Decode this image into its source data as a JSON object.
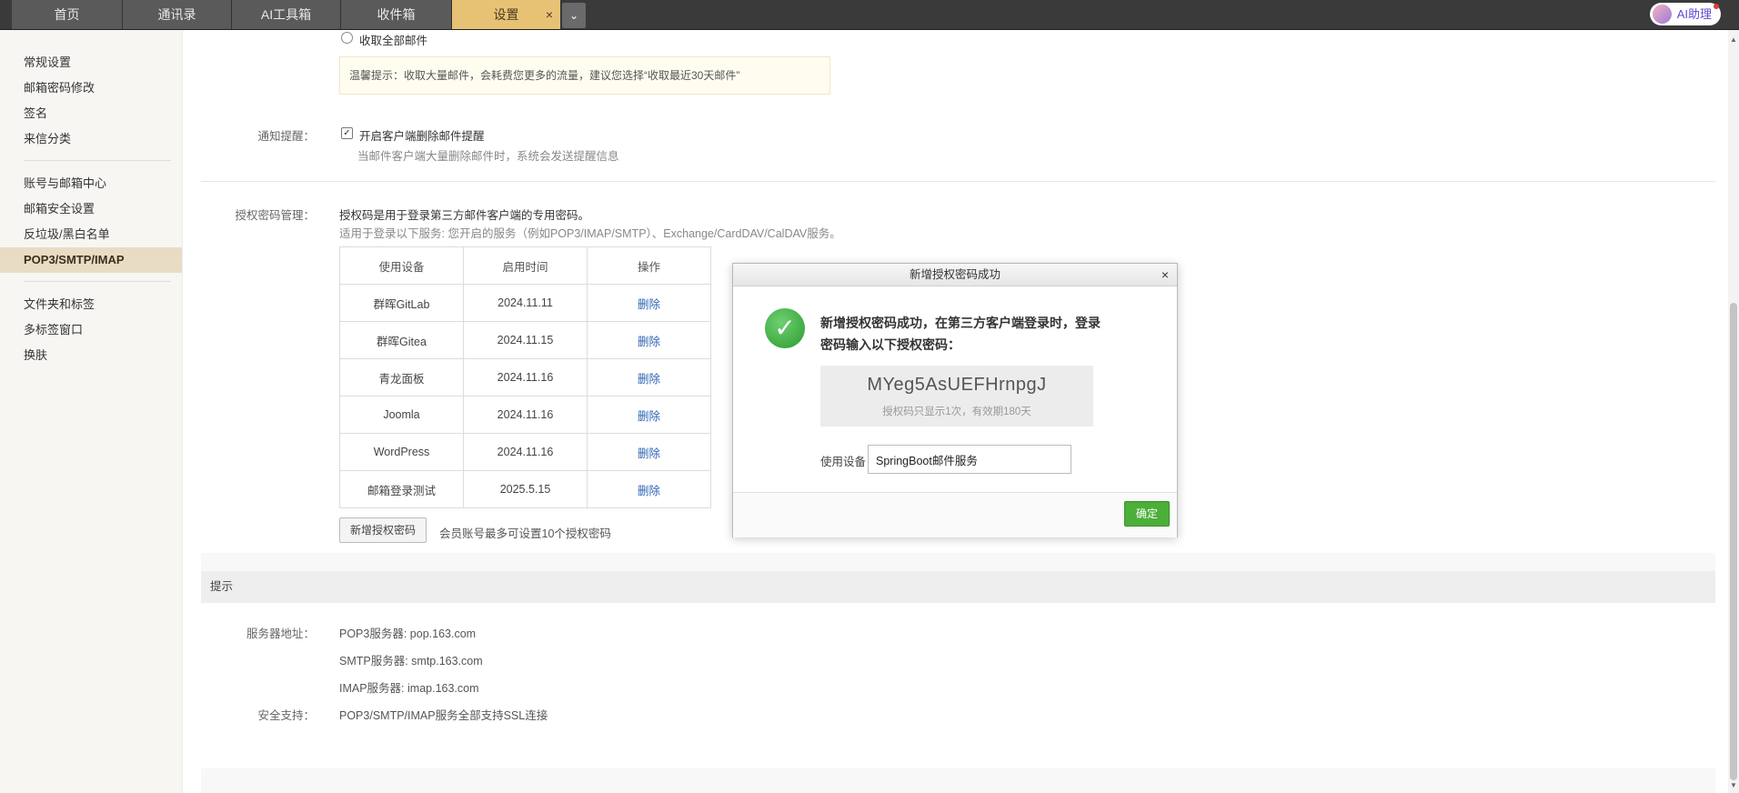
{
  "tabs": [
    {
      "label": "首页"
    },
    {
      "label": "通讯录"
    },
    {
      "label": "AI工具箱"
    },
    {
      "label": "收件箱"
    },
    {
      "label": "设置"
    }
  ],
  "tab_close": "×",
  "tab_more": "⌄",
  "ai_button": "AI助理",
  "sidebar": {
    "groups": [
      [
        "常规设置",
        "邮箱密码修改",
        "签名",
        "来信分类"
      ],
      [
        "账号与邮箱中心",
        "邮箱安全设置",
        "反垃圾/黑白名单",
        "POP3/SMTP/IMAP"
      ],
      [
        "文件夹和标签",
        "多标签窗口",
        "换肤"
      ]
    ],
    "active": "POP3/SMTP/IMAP"
  },
  "receive": {
    "option_all": "收取全部邮件",
    "tip": "温馨提示：收取大量邮件，会耗费您更多的流量，建议您选择“收取最近30天邮件”"
  },
  "notify": {
    "label": "通知提醒：",
    "checkbox_label": "开启客户端删除邮件提醒",
    "checked": true,
    "desc": "当邮件客户端大量删除邮件时，系统会发送提醒信息"
  },
  "auth": {
    "label": "授权密码管理：",
    "desc1": "授权码是用于登录第三方邮件客户端的专用密码。",
    "desc2": "适用于登录以下服务: 您开启的服务（例如POP3/IMAP/SMTP）、Exchange/CardDAV/CalDAV服务。",
    "columns": [
      "使用设备",
      "启用时间",
      "操作"
    ],
    "rows": [
      {
        "device": "群晖GitLab",
        "date": "2024.11.11",
        "action": "删除"
      },
      {
        "device": "群晖Gitea",
        "date": "2024.11.15",
        "action": "删除"
      },
      {
        "device": "青龙面板",
        "date": "2024.11.16",
        "action": "删除"
      },
      {
        "device": "Joomla",
        "date": "2024.11.16",
        "action": "删除"
      },
      {
        "device": "WordPress",
        "date": "2024.11.16",
        "action": "删除"
      },
      {
        "device": "邮箱登录测试",
        "date": "2025.5.15",
        "action": "删除"
      }
    ],
    "add_button": "新增授权密码",
    "limit_note": "会员账号最多可设置10个授权密码"
  },
  "hints": {
    "title": "提示",
    "server_label": "服务器地址：",
    "pop3": "POP3服务器: pop.163.com",
    "smtp": "SMTP服务器: smtp.163.com",
    "imap": "IMAP服务器: imap.163.com",
    "security_label": "安全支持：",
    "security": "POP3/SMTP/IMAP服务全部支持SSL连接"
  },
  "dialog": {
    "title": "新增授权密码成功",
    "close": "×",
    "message": "新增授权密码成功，在第三方客户端登录时，登录密码输入以下授权密码：",
    "code": "MYeg5AsUEFHrnpgJ",
    "code_note": "授权码只显示1次，有效期180天",
    "device_label": "使用设备",
    "device_value": "SpringBoot邮件服务",
    "ok_button": "确定"
  },
  "colors": {
    "active_tab": "#e8c274",
    "sidebar_active": "#e8dcc4",
    "link": "#2d64b3",
    "ok_button": "#4caf3a",
    "success_icon": "#2b9a2f"
  },
  "icons": {
    "success": "check-circle-icon",
    "close": "close-icon",
    "chevron": "chevron-down-icon",
    "avatar": "ai-avatar-icon"
  }
}
